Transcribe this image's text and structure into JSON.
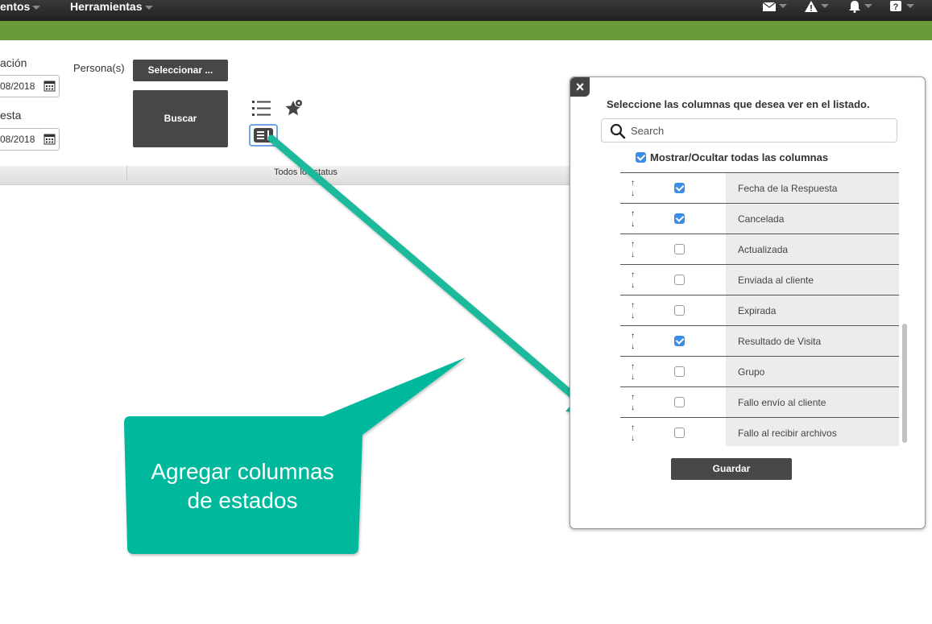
{
  "nav": {
    "item1": "entos",
    "item2": "Herramientas",
    "icons": [
      "envelope-icon",
      "warning-icon",
      "bell-icon",
      "help-icon"
    ]
  },
  "colors": {
    "green_bar": "#6b9a3a",
    "callout": "#00b89c",
    "checkbox_on": "#3b8ee8"
  },
  "form": {
    "label_creacion": "ación",
    "date1": "08/2018",
    "label_respuesta": "esta",
    "date2": "08/2018",
    "persona_label": "Persona(s)",
    "select_button": "Seleccionar ...",
    "buscar_button": "Buscar"
  },
  "table": {
    "status_header": "Todos los status"
  },
  "callout": {
    "text": "Agregar columnas de estados"
  },
  "modal": {
    "title": "Seleccione las columnas que desea ver en el listado.",
    "search_placeholder": "Search",
    "toggle_all_label": "Mostrar/Ocultar todas las columnas",
    "toggle_all_checked": true,
    "columns": [
      {
        "name": "Fecha de la Respuesta",
        "checked": true
      },
      {
        "name": "Cancelada",
        "checked": true
      },
      {
        "name": "Actualizada",
        "checked": false
      },
      {
        "name": "Enviada al cliente",
        "checked": false
      },
      {
        "name": "Expirada",
        "checked": false
      },
      {
        "name": "Resultado de Visita",
        "checked": true
      },
      {
        "name": "Grupo",
        "checked": false
      },
      {
        "name": "Fallo envío al cliente",
        "checked": false
      },
      {
        "name": "Fallo al recibir archivos",
        "checked": false
      }
    ],
    "save_button": "Guardar"
  }
}
